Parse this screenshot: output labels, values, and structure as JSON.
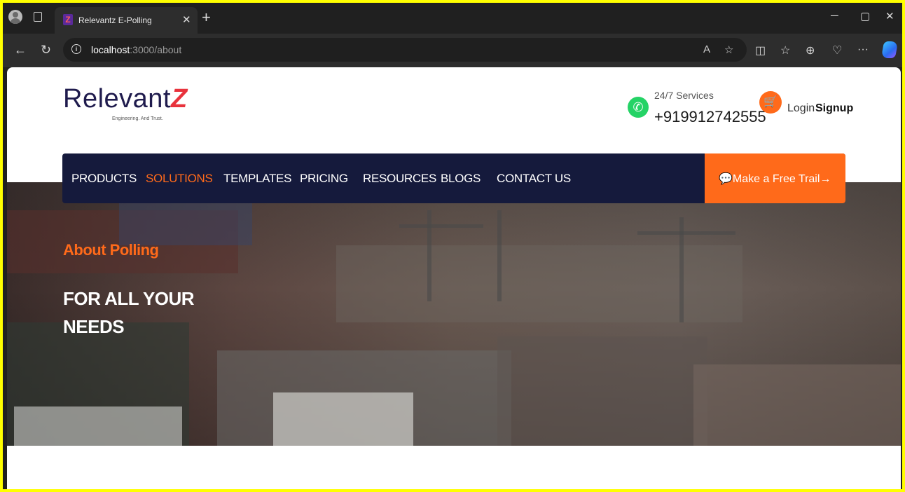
{
  "browser": {
    "tab_title": "Relevantz E-Polling",
    "tab_favicon": "Z",
    "url_host": "localhost",
    "url_path": ":3000/about"
  },
  "header": {
    "logo_main": "Relevant",
    "logo_z": "Z",
    "logo_tagline": "Engineering. And Trust.",
    "services_label": "24/7 Services",
    "phone": "+919912742555",
    "login": "Login",
    "signup": "Signup"
  },
  "nav": {
    "items": [
      {
        "label": "PRODUCTS"
      },
      {
        "label": "SOLUTIONS"
      },
      {
        "label": "TEMPLATES"
      },
      {
        "label": "PRICING"
      },
      {
        "label": "RESOURCES"
      },
      {
        "label": "BLOGS"
      },
      {
        "label": "CONTACT US"
      }
    ],
    "active": "SOLUTIONS",
    "cta_label": "Make a Free Trail"
  },
  "hero": {
    "kicker": "About Polling",
    "title": "FOR ALL YOUR NEEDS"
  },
  "colors": {
    "accent": "#ff6a1a",
    "navy": "#151a3c",
    "highlight_border": "#ffff00"
  }
}
